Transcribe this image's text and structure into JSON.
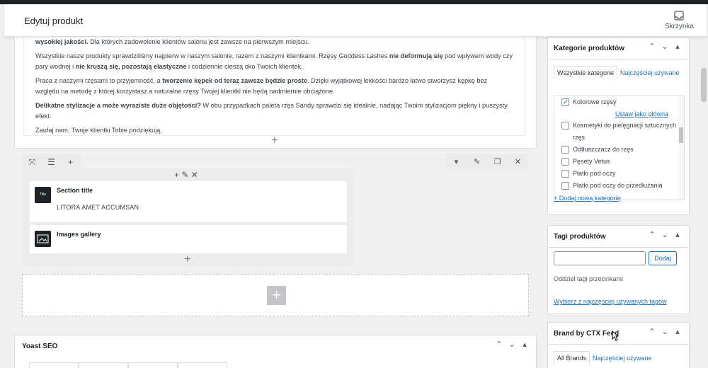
{
  "header": {
    "title": "Edytuj produkt",
    "inbox_label": "Skrzynka",
    "inbox_icon": "inbox-icon"
  },
  "content": {
    "paragraphs": [
      [
        "b:wysokiej jakości.",
        " Dla których zadowolenie klientów salonu jest zawsze na pierwszym miejscu."
      ],
      [
        "Wszystkie nasze produkty sprawdziliśmy najpierw w naszym salonie, razem z naszymi klientkami. Rzęsy Goddess Lashes ",
        "b:nie deformują się",
        " pod wpływem wody czy pary wodnej i ",
        "b:nie kruszą się, pozostają elastyczne",
        " i codziennie cieszą oko Twoich klientek."
      ],
      [
        "Praca z naszymi rzęsami to przyjemność, a ",
        "b:tworzenie kępek od teraz zawsze będzie proste",
        ". Dzięki wyjątkowej lekkości bardzo łatwo stworzysz kępkę bez względu na metodę z której korzystasz a naturalne rzęsy Twojej klientki nie będą nadmiernie obciążone."
      ],
      [
        "b:Delikatne stylizacje a może wyraziste duże objętości?",
        " W obu przypadkach paleta rzęs Sandy sprawdzi się idealnie, nadając Twoim stylizacjom piękny i puszysty efekt."
      ],
      [
        "Zaufaj nam, Twoje klientki Tobie podziękują."
      ]
    ]
  },
  "builder": {
    "elements": [
      {
        "name": "Section title",
        "desc": "LITORA AMET ACCUMSAN",
        "icon_text": "Title"
      },
      {
        "name": "Images gallery",
        "desc": "",
        "icon_text": ""
      }
    ]
  },
  "yoast": {
    "title": "Yoast SEO"
  },
  "categories": {
    "title": "Kategorie produktów",
    "tab_all": "Wszystkie kategorie",
    "tab_popular": "Najczęściej używane",
    "items": [
      {
        "label": "Kolorowe rzęsy",
        "checked": true
      },
      {
        "label": "Kosmetyki do pielęgnacji sztucznych rzęs",
        "checked": false
      },
      {
        "label": "Odtłuszczacz do rzęs",
        "checked": false
      },
      {
        "label": "Pęsety Vetus",
        "checked": false
      },
      {
        "label": "Płatki pod oczy",
        "checked": false
      },
      {
        "label": "Płatki pod oczy do przedłużania",
        "checked": false
      }
    ],
    "make_primary": "Ustaw jako główna",
    "add_new": "+ Dodaj nową kategorię"
  },
  "tags": {
    "title": "Tagi produktów",
    "add_button": "Dodaj",
    "help": "Oddziel tagi przecinkami",
    "choose_popular": "Wybierz z najczęściej używanych tagów"
  },
  "brand": {
    "title": "Brand by CTX Feed",
    "tab_all": "All Brands",
    "tab_popular": "Najczęściej używane"
  },
  "colors": {
    "link": "#2271b1",
    "border": "#dcdcde"
  }
}
